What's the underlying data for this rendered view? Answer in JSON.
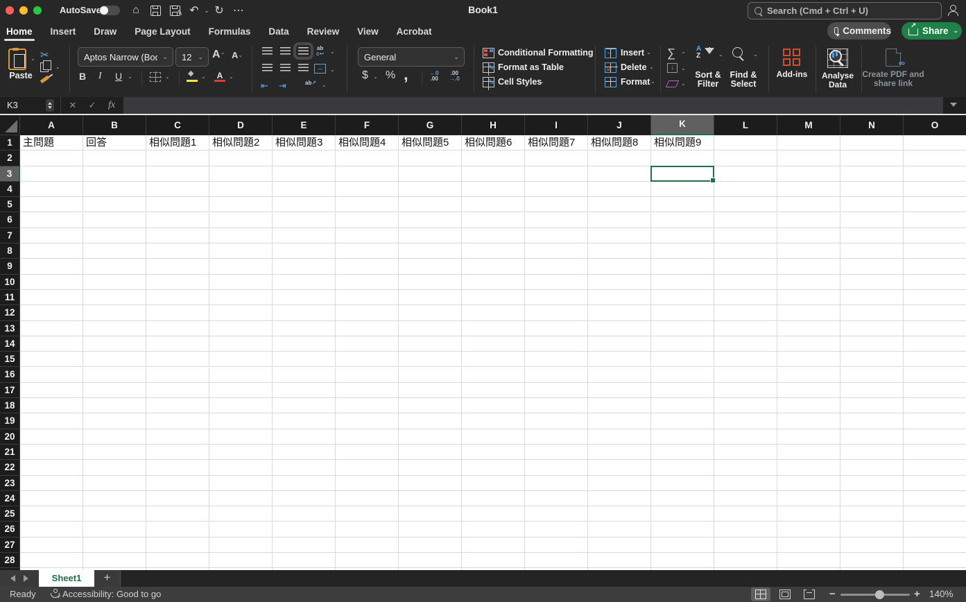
{
  "window": {
    "title": "Book1",
    "autosave_label": "AutoSave",
    "search_placeholder": "Search (Cmd + Ctrl + U)"
  },
  "actions": {
    "comments": "Comments",
    "share": "Share"
  },
  "ribbon": {
    "tabs": [
      {
        "label": "Home",
        "active": true
      },
      {
        "label": "Insert",
        "active": false
      },
      {
        "label": "Draw",
        "active": false
      },
      {
        "label": "Page Layout",
        "active": false
      },
      {
        "label": "Formulas",
        "active": false
      },
      {
        "label": "Data",
        "active": false
      },
      {
        "label": "Review",
        "active": false
      },
      {
        "label": "View",
        "active": false
      },
      {
        "label": "Acrobat",
        "active": false
      }
    ],
    "clipboard": {
      "paste": "Paste"
    },
    "font": {
      "name": "Aptos Narrow (Bod...",
      "size": "12",
      "bold": "B",
      "italic": "I",
      "underline": "U"
    },
    "number": {
      "format": "General",
      "currency": "$",
      "percent": "%",
      "comma": ","
    },
    "styles": {
      "conditional_formatting": "Conditional Formatting",
      "format_as_table": "Format as Table",
      "cell_styles": "Cell Styles"
    },
    "cells": {
      "insert": "Insert",
      "delete": "Delete",
      "format": "Format"
    },
    "editing": {
      "sort_filter": "Sort & Filter",
      "find_select": "Find & Select"
    },
    "addins": {
      "addins": "Add-ins",
      "analyse": "Analyse Data",
      "create_pdf": "Create PDF and share link"
    }
  },
  "formula_bar": {
    "cell_ref": "K3",
    "formula": ""
  },
  "grid": {
    "columns": [
      "A",
      "B",
      "C",
      "D",
      "E",
      "F",
      "G",
      "H",
      "I",
      "J",
      "K",
      "L",
      "M",
      "N",
      "O"
    ],
    "visible_rows": 29,
    "row1_values": [
      "主問題",
      "回答",
      "相似問題1",
      "相似問題2",
      "相似問題3",
      "相似問題4",
      "相似問題5",
      "相似問題6",
      "相似問題7",
      "相似問題8",
      "相似問題9",
      "",
      "",
      "",
      ""
    ],
    "selected_cell": "K3",
    "selected_column": "K",
    "selected_row": 3
  },
  "sheet_bar": {
    "active_sheet": "Sheet1",
    "add_label": "+"
  },
  "status_bar": {
    "ready": "Ready",
    "accessibility": "Accessibility: Good to go",
    "zoom": "140%"
  },
  "colors": {
    "accent_green": "#1E7145",
    "share_green": "#1F8048",
    "addins_orange": "#D0502C",
    "selection_border": "#1E7145"
  }
}
